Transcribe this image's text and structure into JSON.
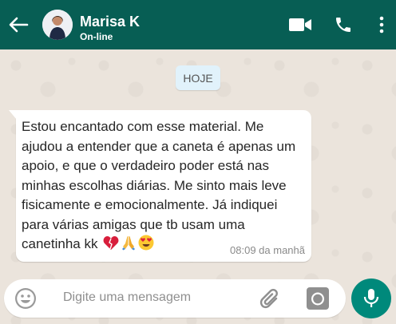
{
  "header": {
    "contact_name": "Marisa K",
    "contact_status": "On-line",
    "icons": [
      "back-arrow-icon",
      "video-call-icon",
      "phone-icon",
      "more-options-icon"
    ]
  },
  "chat": {
    "date_label": "HOJE",
    "message": {
      "text": "Estou encantado com esse material. Me ajudou a entender que a caneta é apenas um apoio, e que o verdadeiro poder está nas minhas escolhas diárias. Me sinto mais leve fisicamente e emocionalmente. Já indiquei para várias amigas que tb usam uma canetinha kk",
      "emojis": [
        "broken-heart-icon",
        "folded-hands-icon",
        "heart-eyes-icon"
      ],
      "time": "08:09 da manhã"
    }
  },
  "composer": {
    "placeholder": "Digite uma mensagem",
    "icons": [
      "emoji-icon",
      "attach-icon",
      "camera-icon",
      "mic-icon"
    ]
  },
  "colors": {
    "header": "#075e54",
    "date_chip": "#e1f2fb",
    "mic_button": "#00897b",
    "wallpaper": "#ebe4dc"
  }
}
